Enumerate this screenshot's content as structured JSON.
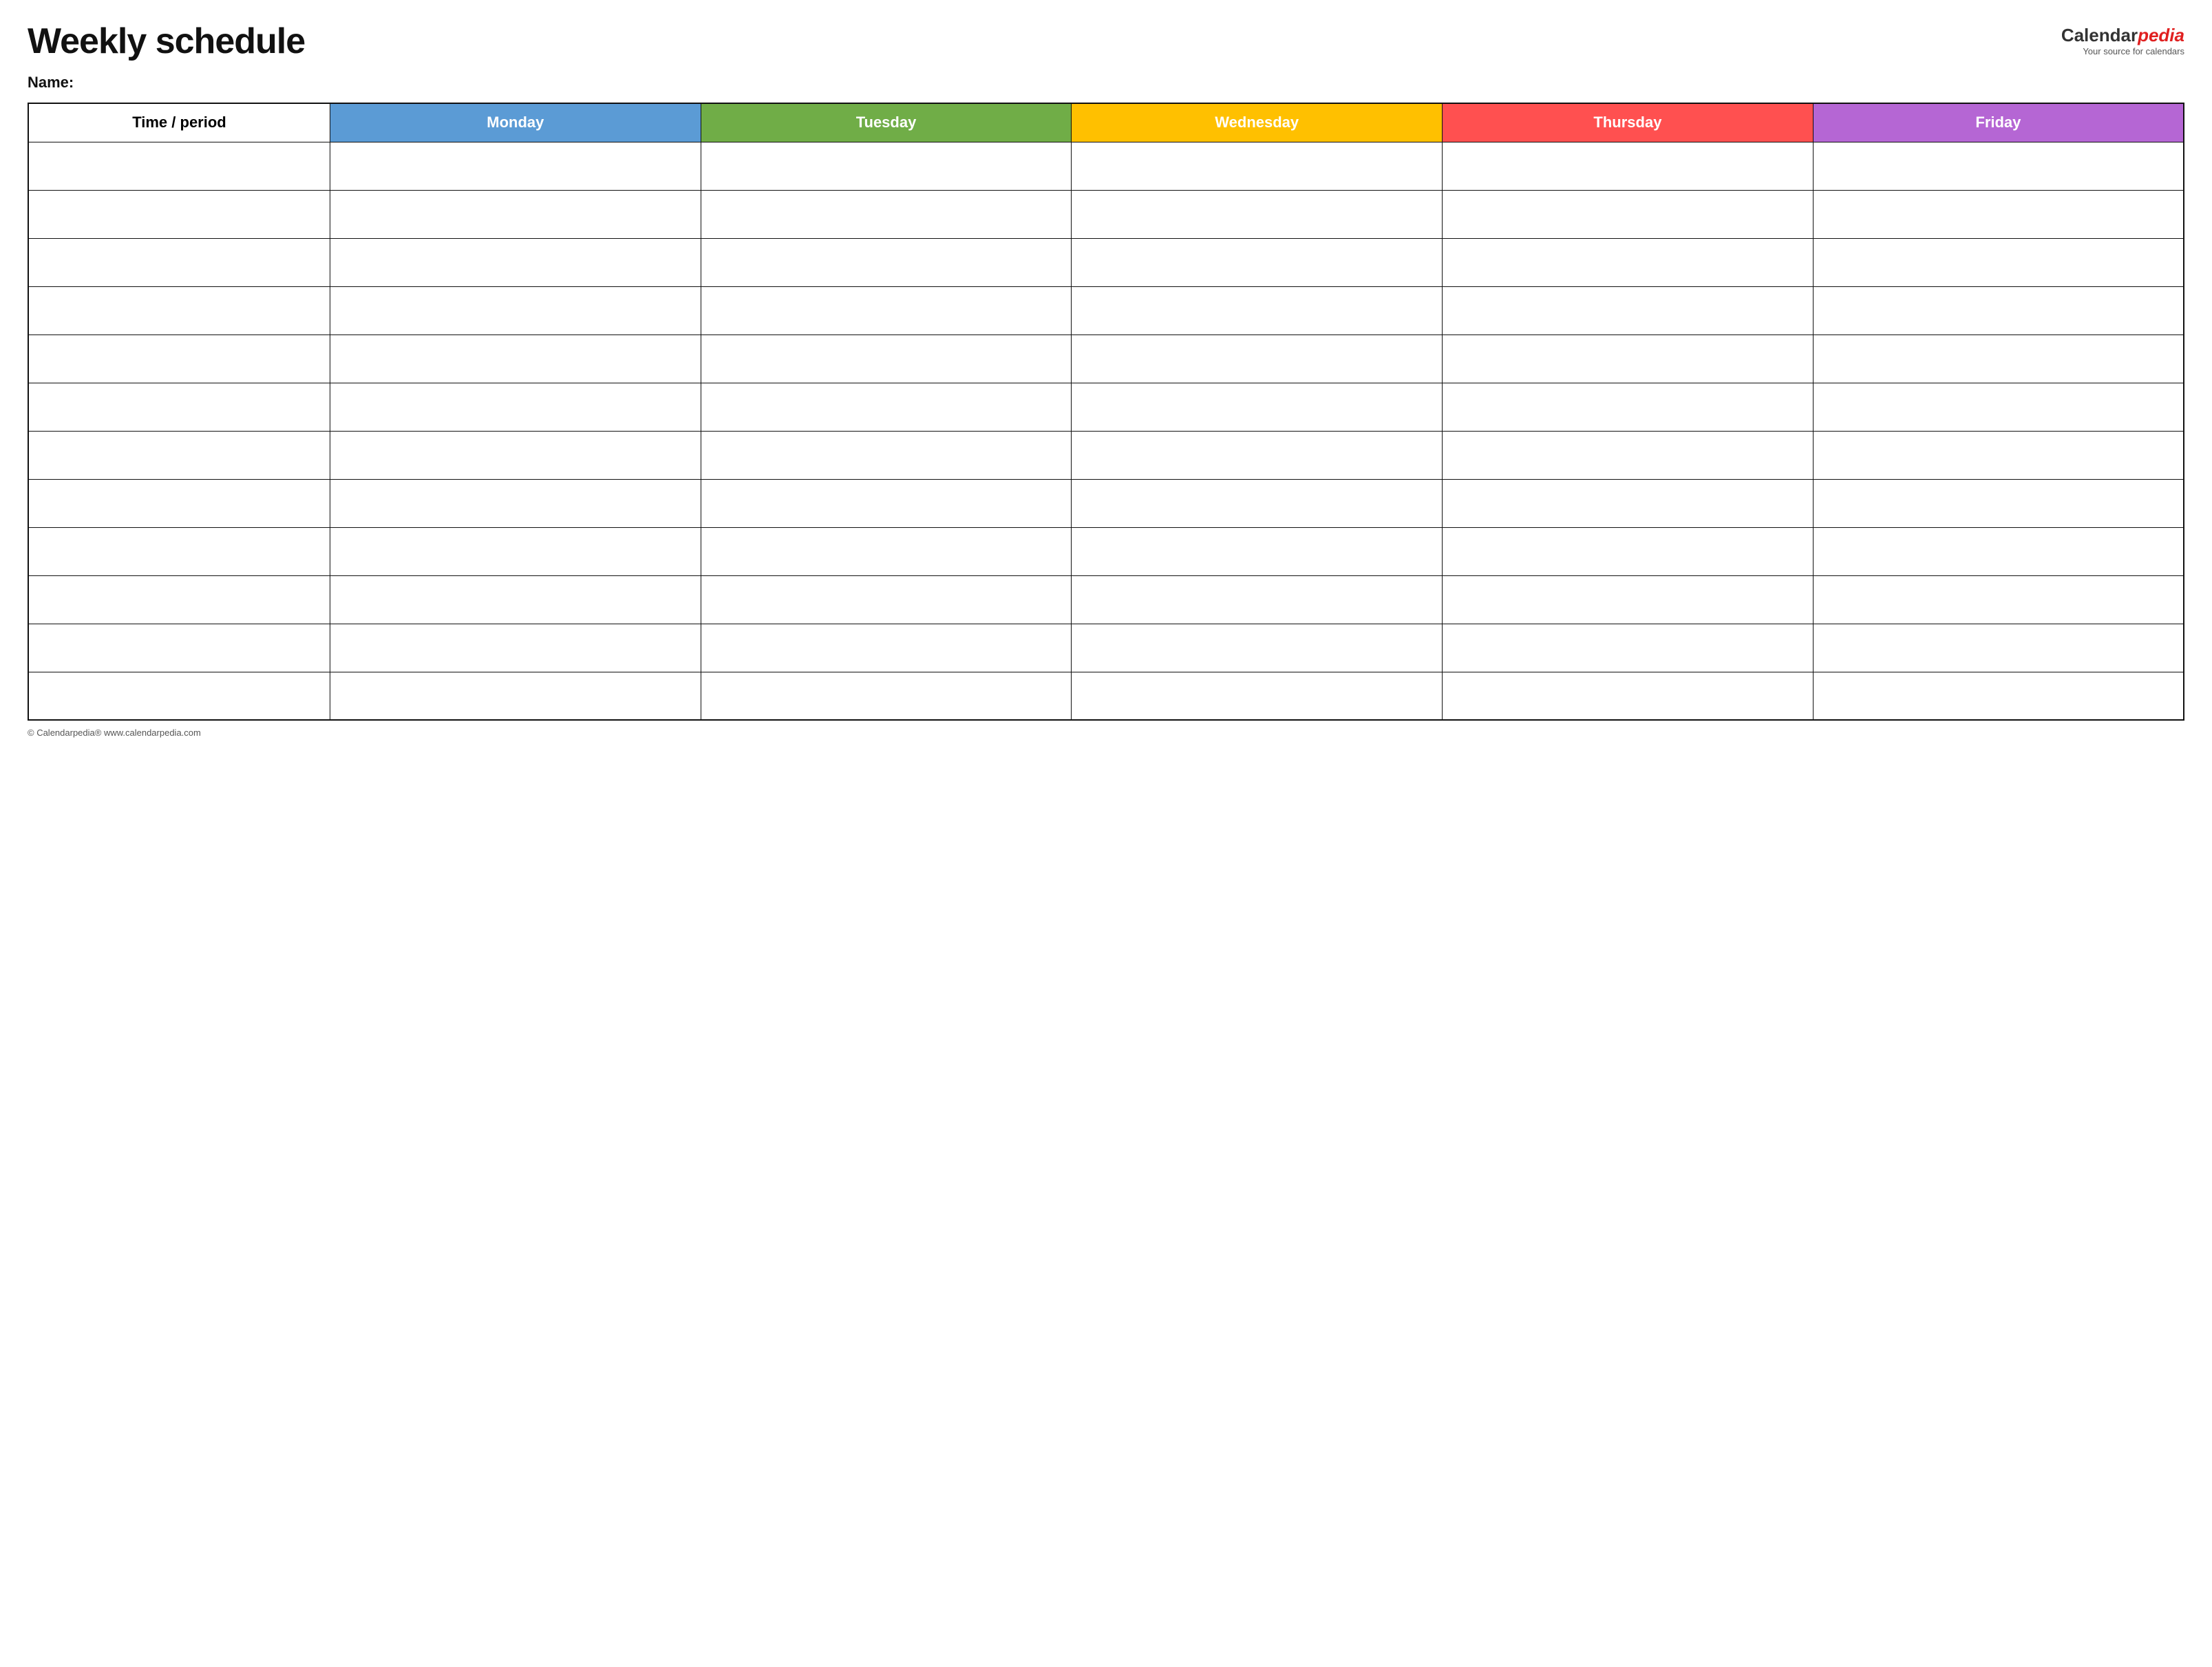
{
  "header": {
    "title": "Weekly schedule",
    "logo_calendar": "Calendar",
    "logo_pedia": "pedia",
    "logo_sub": "Your source for calendars"
  },
  "name_label": "Name:",
  "table": {
    "columns": [
      {
        "id": "time",
        "label": "Time / period",
        "class": "col-time"
      },
      {
        "id": "monday",
        "label": "Monday",
        "class": "col-monday"
      },
      {
        "id": "tuesday",
        "label": "Tuesday",
        "class": "col-tuesday"
      },
      {
        "id": "wednesday",
        "label": "Wednesday",
        "class": "col-wednesday"
      },
      {
        "id": "thursday",
        "label": "Thursday",
        "class": "col-thursday"
      },
      {
        "id": "friday",
        "label": "Friday",
        "class": "col-friday"
      }
    ],
    "row_count": 12
  },
  "footer": "© Calendarpedia®  www.calendarpedia.com"
}
